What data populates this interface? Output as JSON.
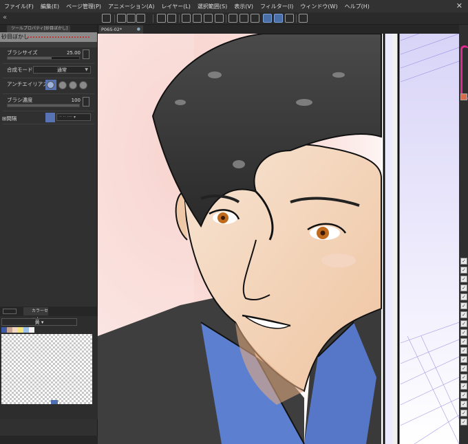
{
  "menubar": {
    "items": [
      "ファイル(F)",
      "編集(E)",
      "ページ管理(P)",
      "アニメーション(A)",
      "レイヤー(L)",
      "選択範囲(S)",
      "表示(V)",
      "フィルター(I)",
      "ウィンドウ(W)",
      "ヘルプ(H)"
    ]
  },
  "tool_property": {
    "tab_label": "ツールプロパティ[砂目ぼかし]",
    "brush_name": "砂目ぼかし",
    "brush_size_label": "ブラシサイズ",
    "brush_size_value": "25.00",
    "blend_mode_label": "合成モード",
    "blend_mode_value": "通常",
    "antialias_label": "アンチエイリアス",
    "density_label": "ブラシ濃度",
    "density_value": "100",
    "spacing_label": "間隔"
  },
  "color_set": {
    "tab_label": "カラーセット",
    "set_name": "黄",
    "swatch_colors": [
      "#3d5ba5",
      "#c8a38f",
      "#f2d6c4",
      "#f4e27a",
      "#9bc1e8",
      "#f5f5f5"
    ]
  },
  "document": {
    "tab_label": "P06S-02*"
  },
  "colors": {
    "accent": "#5773b3"
  }
}
